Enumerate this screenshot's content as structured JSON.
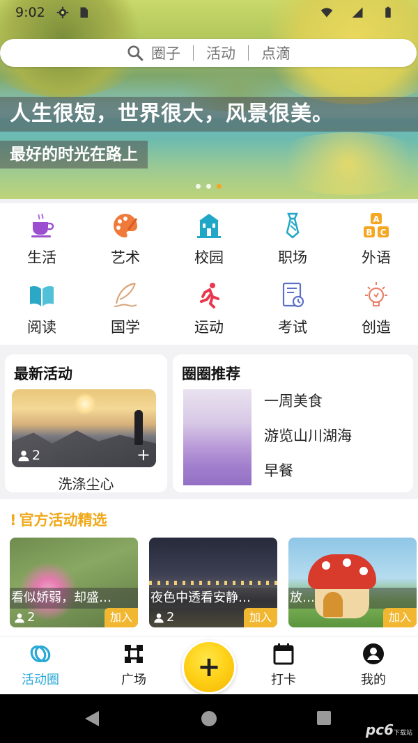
{
  "status": {
    "time": "9:02"
  },
  "search": {
    "items": [
      "圈子",
      "活动",
      "点滴"
    ]
  },
  "banner": {
    "slogan_main": "人生很短，世界很大，风景很美。",
    "slogan_sub": "最好的时光在路上",
    "active_dot": 3
  },
  "categories": [
    {
      "label": "生活",
      "icon": "coffee-cup-icon",
      "color": "#9b4fd0"
    },
    {
      "label": "艺术",
      "icon": "palette-icon",
      "color": "#f07a3a"
    },
    {
      "label": "校园",
      "icon": "school-building-icon",
      "color": "#20a7c7"
    },
    {
      "label": "职场",
      "icon": "necktie-icon",
      "color": "#20a7c7"
    },
    {
      "label": "外语",
      "icon": "abc-blocks-icon",
      "color": "#f5a623"
    },
    {
      "label": "阅读",
      "icon": "open-book-icon",
      "color": "#2aa8c5"
    },
    {
      "label": "国学",
      "icon": "quill-icon",
      "color": "#d9a57a"
    },
    {
      "label": "运动",
      "icon": "running-person-icon",
      "color": "#e8384f"
    },
    {
      "label": "考试",
      "icon": "exam-paper-icon",
      "color": "#5b6fc6"
    },
    {
      "label": "创造",
      "icon": "lightbulb-icon",
      "color": "#e8806a"
    }
  ],
  "latest": {
    "title": "最新活动",
    "count": "2",
    "caption": "洗涤尘心"
  },
  "circle": {
    "title": "圈圈推荐",
    "items": [
      "一周美食",
      "游览山川湖海",
      "早餐"
    ]
  },
  "official": {
    "title": "官方活动精选",
    "bang": "!",
    "cards": [
      {
        "title": "看似娇弱，却盛…",
        "count": "2",
        "join": "加入"
      },
      {
        "title": "夜色中透看安静…",
        "count": "2",
        "join": "加入"
      },
      {
        "title": "放…",
        "count": "",
        "join": "加入"
      }
    ]
  },
  "tabs": [
    {
      "label": "活动圈",
      "icon": "rings-icon"
    },
    {
      "label": "广场",
      "icon": "square-plaza-icon"
    },
    {
      "label": "打卡",
      "icon": "calendar-icon"
    },
    {
      "label": "我的",
      "icon": "user-circle-icon"
    }
  ],
  "fab": {
    "label": "+"
  },
  "watermark": {
    "main": "pc6",
    "sub": "下载站"
  },
  "colors": {
    "accent": "#2aa8d6",
    "highlight": "#f0a818",
    "join": "#f2b730"
  }
}
